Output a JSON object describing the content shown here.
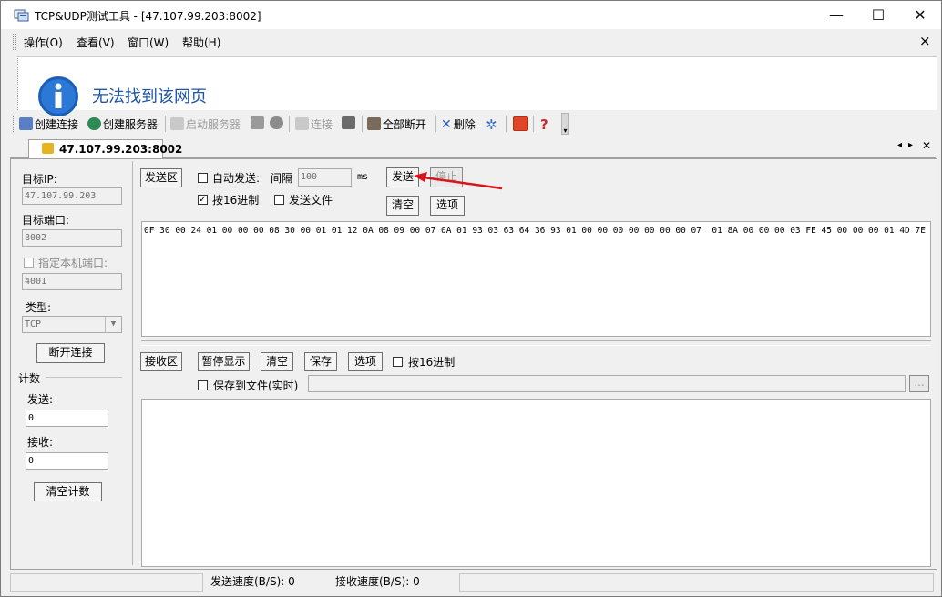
{
  "window": {
    "title": "TCP&UDP测试工具 - [47.107.99.203:8002]",
    "minimize": "—",
    "maximize": "☐",
    "close": "✕"
  },
  "menu": {
    "items": [
      "操作(O)",
      "查看(V)",
      "窗口(W)",
      "帮助(H)"
    ],
    "close": "×"
  },
  "banner": {
    "icon": "info-icon",
    "text": "无法找到该网页"
  },
  "toolbar": {
    "create_connection": "创建连接",
    "create_server": "创建服务器",
    "start_server": "启动服务器",
    "connect": "连接",
    "disconnect_all": "全部断开",
    "delete": "删除"
  },
  "tab": {
    "label": "47.107.99.203:8002",
    "nav_prev": "◂",
    "nav_next": "▸",
    "close": "✕"
  },
  "left": {
    "target_ip_label": "目标IP:",
    "target_ip": "47.107.99.203",
    "target_port_label": "目标端口:",
    "target_port": "8002",
    "local_port_label": "指定本机端口:",
    "local_port": "4001",
    "type_label": "类型:",
    "type_value": "TCP",
    "disconnect_button": "断开连接",
    "count_label": "计数",
    "send_label": "发送:",
    "send_count": "0",
    "recv_label": "接收:",
    "recv_count": "0",
    "clear_count_button": "清空计数"
  },
  "send": {
    "area_label": "发送区",
    "auto_send_label": "自动发送:",
    "interval_label": "间隔",
    "interval_value": "100",
    "interval_unit": "ms",
    "send_button": "发送",
    "stop_button": "停止",
    "hex_label": "按16进制",
    "hex_checked": true,
    "send_file_label": "发送文件",
    "clear_button": "清空",
    "options_button": "选项",
    "data": "0F 30 00 24 01 00 00 00 08 30 00 01 01 12 0A 08 09 00 07 0A 01 93 03 63 64 36 93 01 00 00 00 00 00 00 00 07  01 8A 00 00 00 03 FE 45 00 00 00 01 4D 7E"
  },
  "recv": {
    "area_label": "接收区",
    "pause_button": "暂停显示",
    "clear_button": "清空",
    "save_button": "保存",
    "options_button": "选项",
    "hex_label": "按16进制",
    "save_file_label": "保存到文件(实时)",
    "browse_button": "...",
    "data": ""
  },
  "status": {
    "send_speed": "发送速度(B/S): 0",
    "recv_speed": "接收速度(B/S): 0"
  },
  "colors": {
    "annotation_arrow": "#d9141b",
    "banner_text": "#1f55a8",
    "info_icon": "#1a5fb4"
  }
}
